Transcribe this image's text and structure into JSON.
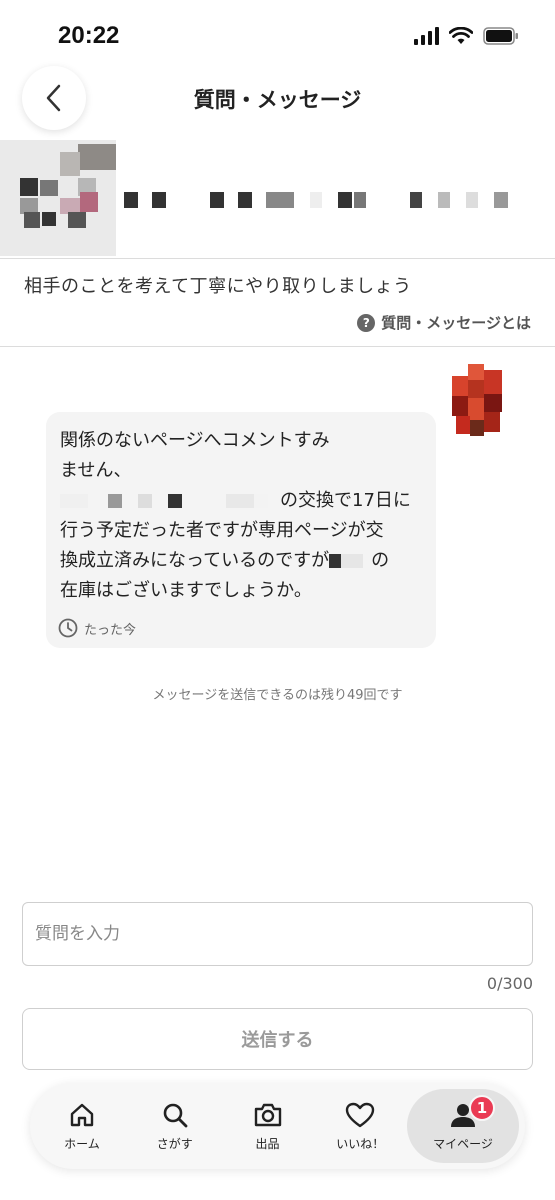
{
  "status_bar": {
    "time": "20:22"
  },
  "header": {
    "title": "質問・メッセージ"
  },
  "notice": {
    "text": "相手のことを考えて丁寧にやり取りしましょう",
    "help_link": "質問・メッセージとは",
    "help_icon": "?"
  },
  "message": {
    "line1": "関係のないページへコメントすみ",
    "line2": "ません、",
    "line3_after_redaction": "の交換で17日に",
    "line4": "行う予定だった者ですが専用ページが交",
    "line5_before_redaction": "換成立済みになっているのですが",
    "line5_after_redaction": "の",
    "line6": "在庫はございますでしょうか。",
    "time": "たった今"
  },
  "remaining_note": "メッセージを送信できるのは残り49回です",
  "input": {
    "placeholder": "質問を入力",
    "value": "",
    "char_count": "0/300"
  },
  "send_button": {
    "label": "送信する"
  },
  "tab_bar": {
    "items": [
      {
        "label": "ホーム",
        "icon": "home-icon"
      },
      {
        "label": "さがす",
        "icon": "search-icon"
      },
      {
        "label": "出品",
        "icon": "camera-icon"
      },
      {
        "label": "いいね！",
        "icon": "heart-icon"
      },
      {
        "label": "マイページ",
        "icon": "person-icon",
        "badge": "1",
        "active": true
      }
    ]
  },
  "colors": {
    "badge": "#ea3b54",
    "bubble": "#f4f4f4",
    "active_tab": "#e2e2e2"
  }
}
